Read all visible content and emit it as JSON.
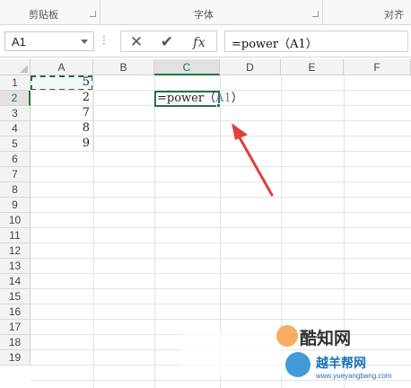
{
  "ribbon": {
    "groups": [
      {
        "label": "剪贴板"
      },
      {
        "label": "字体"
      },
      {
        "label": "对齐"
      }
    ]
  },
  "formula_bar": {
    "name_box": "A1",
    "cancel_icon": "close-icon",
    "enter_icon": "check-icon",
    "fx_label": "fx",
    "formula": "=power（A1）"
  },
  "grid": {
    "columns": [
      "A",
      "B",
      "C",
      "D",
      "E",
      "F"
    ],
    "rows": [
      "1",
      "2",
      "3",
      "4",
      "5",
      "6",
      "7",
      "8",
      "9",
      "10",
      "11",
      "12",
      "13",
      "14",
      "15",
      "16",
      "17",
      "18",
      "19"
    ],
    "cells": {
      "A1": "5",
      "A2": "2",
      "A3": "7",
      "A4": "8",
      "A5": "9"
    },
    "active_cell": {
      "ref": "C2",
      "prefix": "=power（",
      "arg": "A1",
      "suffix": "）"
    }
  },
  "watermark": {
    "title": "酷知网",
    "brand": "越羊帮网",
    "url": "www.yueyangbang.com"
  },
  "colors": {
    "excel_green": "#217346",
    "ref_blue": "#5b86b5",
    "arrow_red": "#e0403a"
  }
}
